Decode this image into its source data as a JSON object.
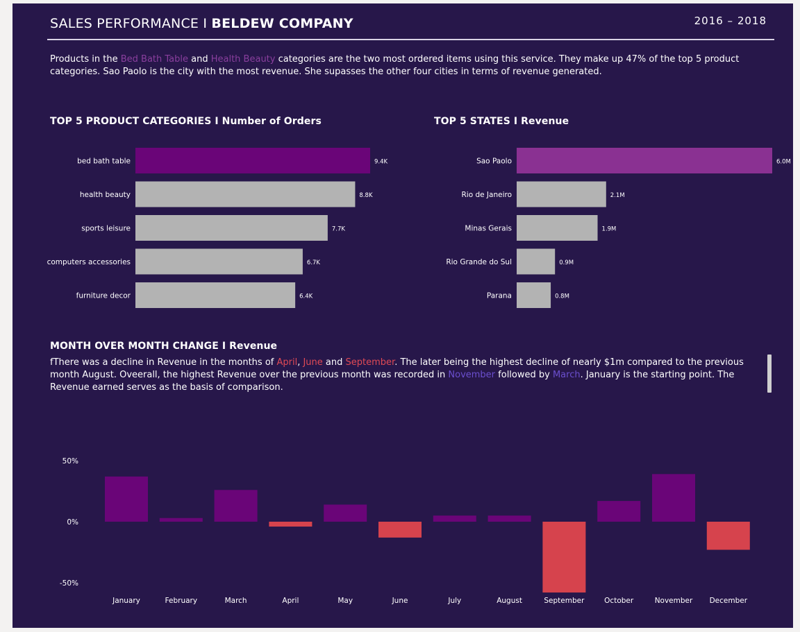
{
  "header": {
    "title_regular": "SALES PERFORMANCE I ",
    "title_bold": "BELDEW COMPANY",
    "years": "2016 – 2018"
  },
  "intro": {
    "t1": "Products in the ",
    "h1": "Bed Bath Table",
    "t2": " and ",
    "h2": "Health Beauty",
    "t3": " categories are the two most ordered items using this service.  They make up 47% of the top 5 product categories. Sao Paolo is the city with the most revenue. She supasses the other four cities in terms of revenue generated."
  },
  "mom": {
    "title": "MONTH OVER MONTH CHANGE I Revenue",
    "t1": "fThere was a decline in Revenue in the months of ",
    "r1": "April",
    "t2": ", ",
    "r2": "June",
    "t3": " and ",
    "r3": "September",
    "t4": ".  The later being the highest decline of nearly $1m compared to the previous month August. Oveerall, the highest Revenue over the previous month was recorded in ",
    "b1": "November",
    "t5": " followed by ",
    "b2": "March",
    "t6": ".  January is the starting point. The Revenue earned serves as the basis of comparison."
  },
  "colors": {
    "background": "#27174a",
    "highlight_bar": "#6a0578",
    "highlight_bar_states": "#8a3192",
    "neutral_bar": "#b3b3b3",
    "positive_bar": "#6a0578",
    "negative_bar": "#d6434d"
  },
  "chart_data": [
    {
      "type": "bar",
      "orientation": "horizontal",
      "title": "TOP 5 PRODUCT CATEGORIES I Number of Orders",
      "categories": [
        "bed bath table",
        "health beauty",
        "sports leisure",
        "computers accessories",
        "furniture decor"
      ],
      "values": [
        9400,
        8800,
        7700,
        6700,
        6400
      ],
      "data_labels": [
        "9.4K",
        "8.8K",
        "7.7K",
        "6.7K",
        "6.4K"
      ],
      "highlight": "bed bath table",
      "xlim": [
        0,
        9400
      ]
    },
    {
      "type": "bar",
      "orientation": "horizontal",
      "title": "TOP 5 STATES I Revenue",
      "categories": [
        "Sao Paolo",
        "Rio de Janeiro",
        "Minas Gerais",
        "Rio Grande do Sul",
        "Parana"
      ],
      "values": [
        6.0,
        2.1,
        1.9,
        0.9,
        0.8
      ],
      "data_labels": [
        "6.0M",
        "2.1M",
        "1.9M",
        "0.9M",
        "0.8M"
      ],
      "highlight": "Sao Paolo",
      "xlim": [
        0,
        6.0
      ]
    },
    {
      "type": "bar",
      "orientation": "vertical",
      "categories": [
        "January",
        "February",
        "March",
        "April",
        "May",
        "June",
        "July",
        "August",
        "September",
        "October",
        "November",
        "December"
      ],
      "values": [
        37,
        3,
        26,
        -4,
        14,
        -13,
        5,
        5,
        -58,
        17,
        39,
        -23
      ],
      "y_ticks": [
        "50%",
        "0%",
        "-50%"
      ],
      "ylim": [
        -50,
        50
      ],
      "grid": false
    }
  ]
}
